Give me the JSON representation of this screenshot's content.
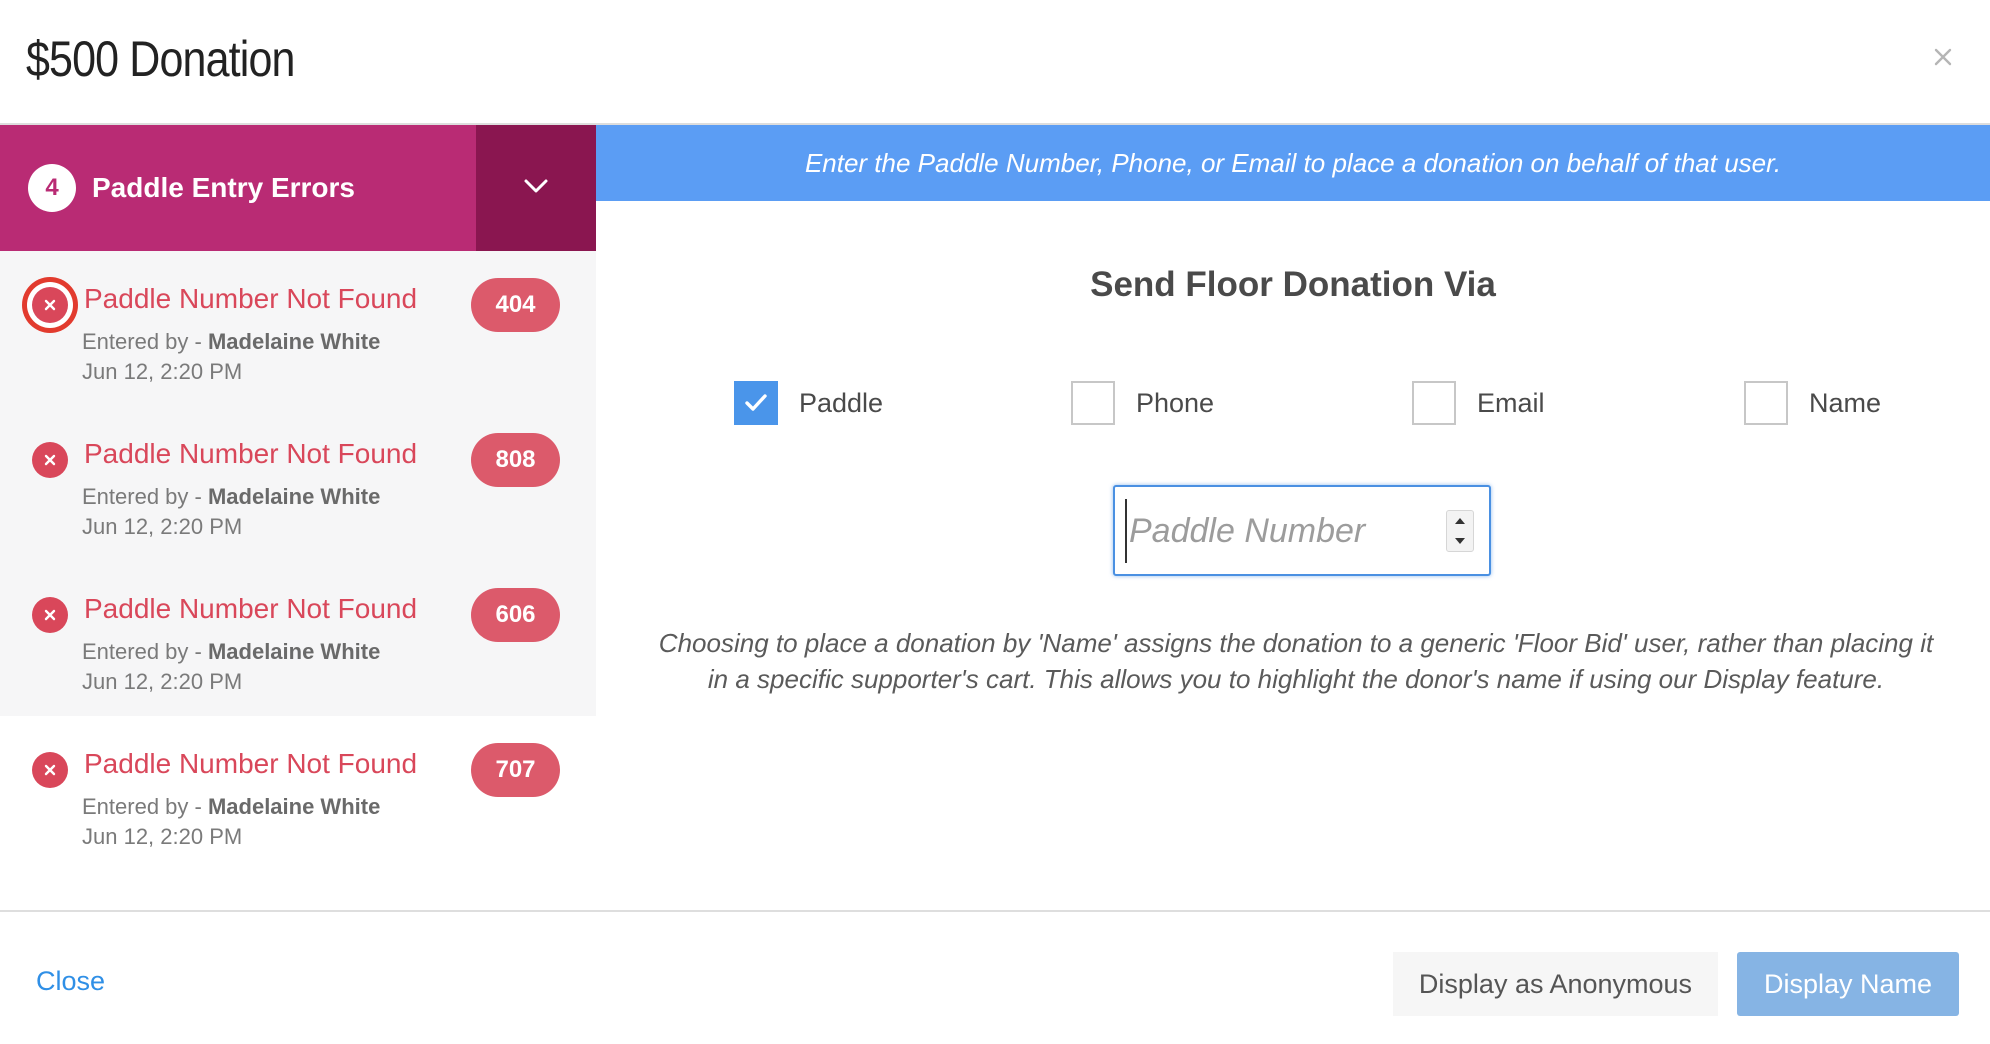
{
  "modal": {
    "title": "$500 Donation",
    "close_icon": "close-icon"
  },
  "errors_panel": {
    "count": "4",
    "title": "Paddle Entry Errors",
    "toggle_icon": "chevron-down-icon",
    "items": [
      {
        "title": "Paddle Number Not Found",
        "entered_by_label": "Entered by - ",
        "entered_by": "Madelaine White",
        "date": "Jun 12, 2:20 PM",
        "paddle": "404"
      },
      {
        "title": "Paddle Number Not Found",
        "entered_by_label": "Entered by - ",
        "entered_by": "Madelaine White",
        "date": "Jun 12, 2:20 PM",
        "paddle": "808"
      },
      {
        "title": "Paddle Number Not Found",
        "entered_by_label": "Entered by - ",
        "entered_by": "Madelaine White",
        "date": "Jun 12, 2:20 PM",
        "paddle": "606"
      },
      {
        "title": "Paddle Number Not Found",
        "entered_by_label": "Entered by - ",
        "entered_by": "Madelaine White",
        "date": "Jun 12, 2:20 PM",
        "paddle": "707"
      }
    ]
  },
  "main": {
    "banner": "Enter the Paddle Number, Phone, or Email to place a donation on behalf of that user.",
    "section_title": "Send Floor Donation Via",
    "options": [
      {
        "label": "Paddle",
        "checked": true
      },
      {
        "label": "Phone",
        "checked": false
      },
      {
        "label": "Email",
        "checked": false
      },
      {
        "label": "Name",
        "checked": false
      }
    ],
    "input": {
      "placeholder": "Paddle Number",
      "value": ""
    },
    "help_text": "Choosing to place a donation by 'Name' assigns the donation to a generic 'Floor Bid' user, rather than placing it in a specific supporter's cart. This allows you to highlight the donor's name if using our Display feature."
  },
  "footer": {
    "close_label": "Close",
    "anonymous_label": "Display as Anonymous",
    "display_name_label": "Display Name"
  },
  "colors": {
    "brand_magenta": "#b92b74",
    "brand_magenta_dark": "#8a1650",
    "error_red": "#d9475a",
    "banner_blue": "#5b9df4",
    "checkbox_blue": "#4a95ea",
    "link_blue": "#2f8fe6",
    "primary_button": "#86b4e4",
    "highlight_ring": "#e23b2e"
  }
}
